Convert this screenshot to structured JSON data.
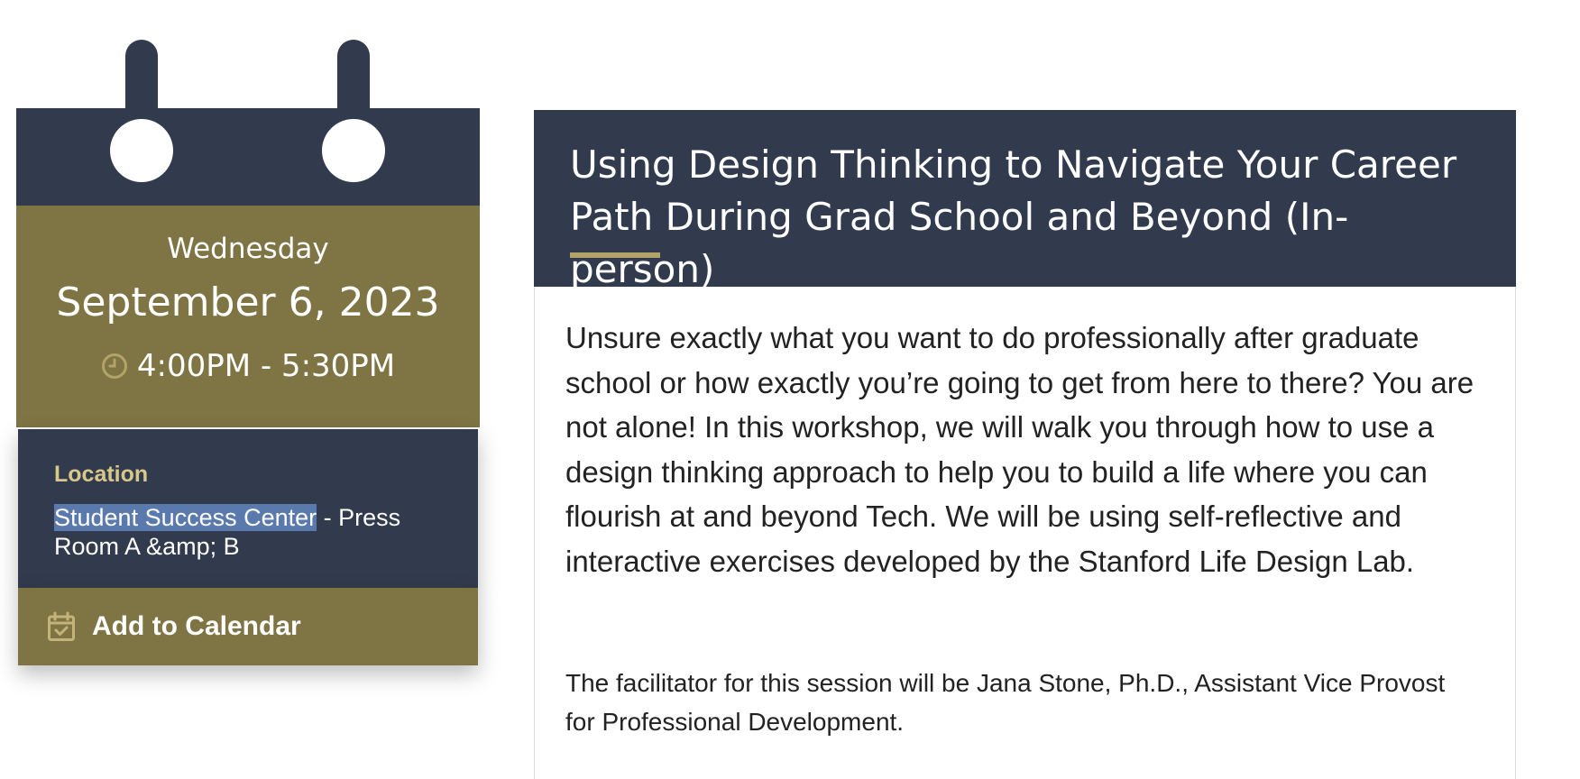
{
  "calendar": {
    "weekday": "Wednesday",
    "date": "September 6, 2023",
    "time": "4:00PM - 5:30PM",
    "clock_icon": "clock-icon",
    "location_label": "Location",
    "location_selected": "Student Success Center",
    "location_rest": " - Press Room A &amp; B",
    "add_label": "Add to Calendar",
    "add_icon": "calendar-check-icon"
  },
  "event": {
    "title": "Using Design Thinking to Navigate Your Career Path During Grad School and Beyond (In-person)",
    "description": "Unsure exactly what you want to do professionally after graduate school or how exactly you’re going to get from here to there? You are not alone! In this workshop, we will walk you through how to use a design thinking approach to help you to build a life where you can flourish at and beyond Tech. We will be using self-reflective and interactive exercises developed by the Stanford Life Design Lab.",
    "facilitator": "The facilitator for this session will be Jana Stone, Ph.D., Assistant Vice Provost for Professional Development."
  },
  "colors": {
    "navy": "#323b4e",
    "gold": "#7f7443",
    "gold_light": "#b3a369",
    "selection": "#5a7aad"
  }
}
